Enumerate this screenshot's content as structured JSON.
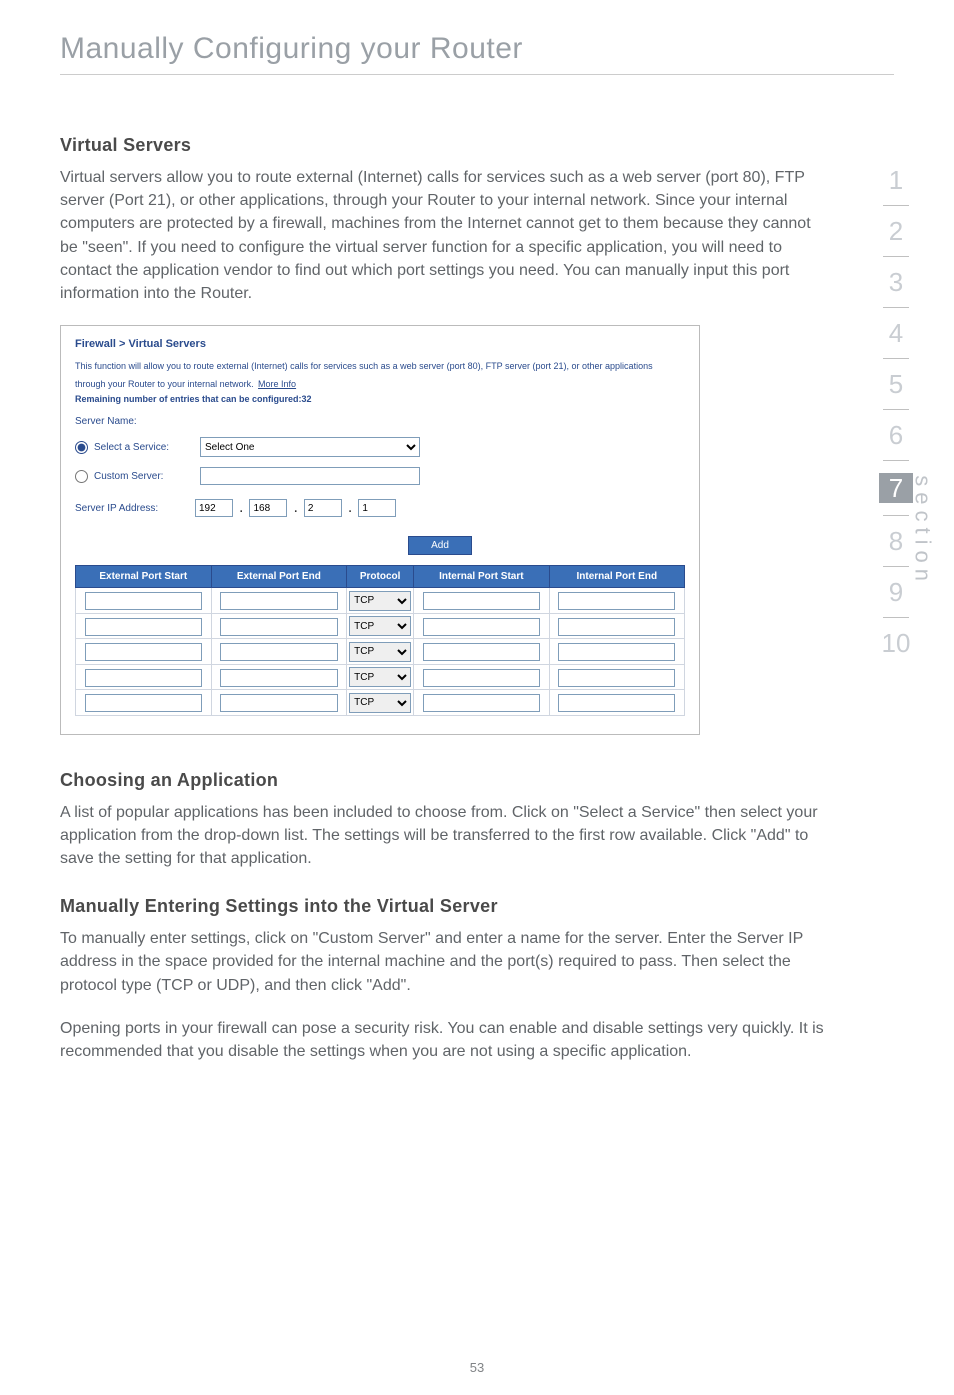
{
  "page": {
    "title": "Manually Configuring your Router",
    "number": "53"
  },
  "sections": {
    "virtual_servers": {
      "heading": "Virtual Servers",
      "body": "Virtual servers allow you to route external (Internet) calls for services such as a web server (port 80), FTP server (Port 21), or other applications, through your Router to your internal network. Since your internal computers are protected by a firewall, machines from the Internet cannot get to them because they cannot be \"seen\". If you need to configure the virtual server function for a specific application, you will need to contact the application vendor to find out which port settings you need. You can manually input this port information into the Router."
    },
    "choosing_app": {
      "heading": "Choosing an Application",
      "body": "A list of popular applications has been included to choose from. Click on \"Select a Service\" then select your application from the drop-down list. The settings will be transferred to the first row available. Click \"Add\" to save the setting for that application."
    },
    "manual_entry": {
      "heading": "Manually Entering Settings into the Virtual Server",
      "body1": "To manually enter settings, click on \"Custom Server\" and enter a name for the server. Enter the Server IP address in the space provided for the internal machine and the port(s) required to pass. Then select the protocol type (TCP or UDP), and then click \"Add\".",
      "body2": "Opening ports in your firewall can pose a security risk. You can enable and disable settings very quickly. It is recommended that you disable the settings when you are not using a specific application."
    }
  },
  "screenshot": {
    "title": "Firewall > Virtual Servers",
    "desc": "This function will allow you to route external (Internet) calls for services such as a web server (port 80), FTP server (port 21), or other applications through your Router to your internal network.",
    "more_info": "More Info",
    "remaining": "Remaining number of entries that can be configured:32",
    "server_name_label": "Server Name:",
    "select_service_label": "Select a Service:",
    "select_service_value": "Select One",
    "custom_server_label": "Custom Server:",
    "ip_label": "Server IP Address:",
    "ip_octets": [
      "192",
      "168",
      "2",
      "1"
    ],
    "add_button": "Add",
    "table": {
      "headers": [
        "External Port Start",
        "External Port End",
        "Protocol",
        "Internal Port Start",
        "Internal Port End"
      ],
      "protocol_option": "TCP",
      "row_count": 5
    }
  },
  "nav": {
    "items": [
      "1",
      "2",
      "3",
      "4",
      "5",
      "6",
      "7",
      "8",
      "9",
      "10"
    ],
    "active_index": 6,
    "vertical_label": "section"
  }
}
